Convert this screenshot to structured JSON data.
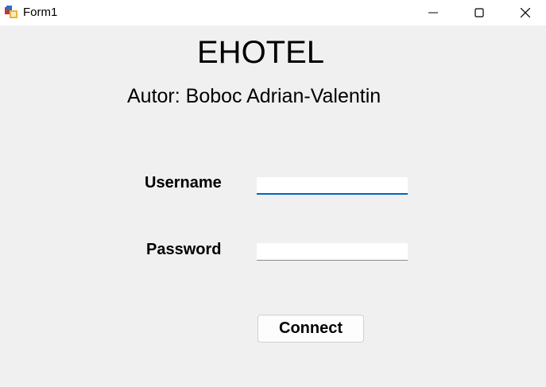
{
  "window": {
    "title": "Form1",
    "app_icon": "winforms-app-icon",
    "controls": [
      "minimize-icon",
      "maximize-icon",
      "close-icon"
    ]
  },
  "heading": "EHOTEL",
  "author": "Autor: Boboc Adrian-Valentin",
  "form": {
    "username_label": "Username",
    "username_value": "",
    "password_label": "Password",
    "password_value": "",
    "connect_label": "Connect"
  },
  "colors": {
    "background": "#f0f0f0",
    "focus_accent": "#0067c0"
  }
}
